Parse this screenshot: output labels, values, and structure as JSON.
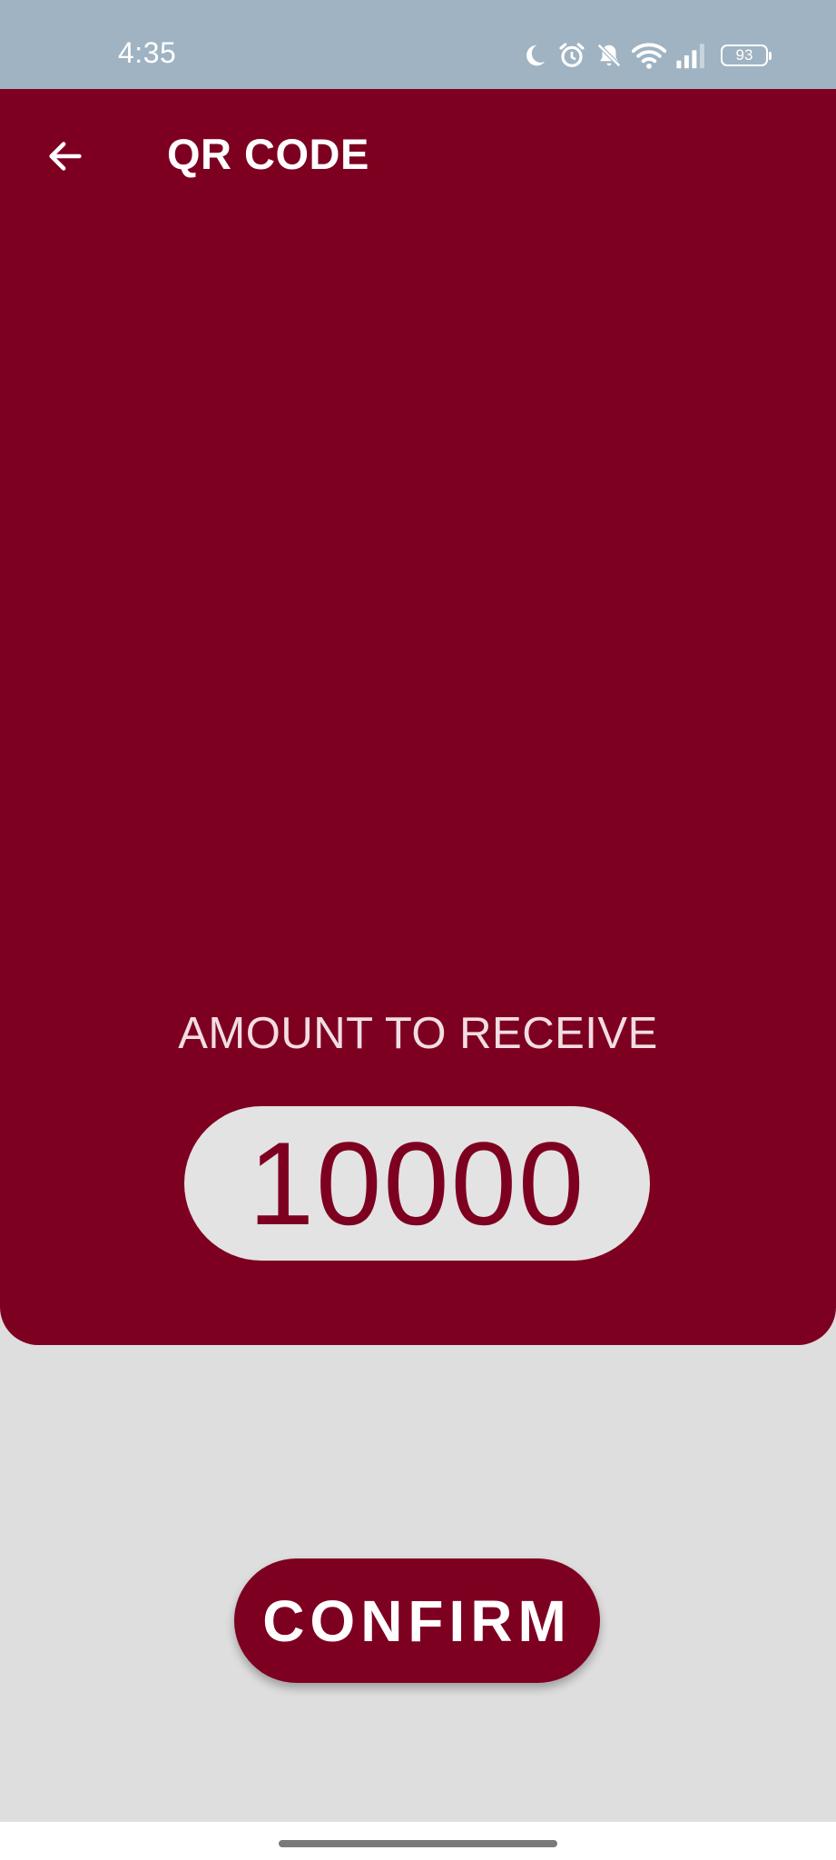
{
  "status_bar": {
    "time": "4:35",
    "battery": "93",
    "icons": [
      "moon-icon",
      "alarm-icon",
      "bell-off-icon",
      "wifi-icon",
      "signal-icon",
      "battery-icon"
    ]
  },
  "app_bar": {
    "title": "QR CODE",
    "back_icon": "arrow-left-icon"
  },
  "amount": {
    "label": "AMOUNT TO RECEIVE",
    "value": "10000"
  },
  "actions": {
    "confirm_label": "CONFIRM"
  },
  "colors": {
    "primary": "#7e0021",
    "background": "#dedede",
    "status_bar": "#9fb3c2",
    "pill": "#e3e3e3"
  }
}
